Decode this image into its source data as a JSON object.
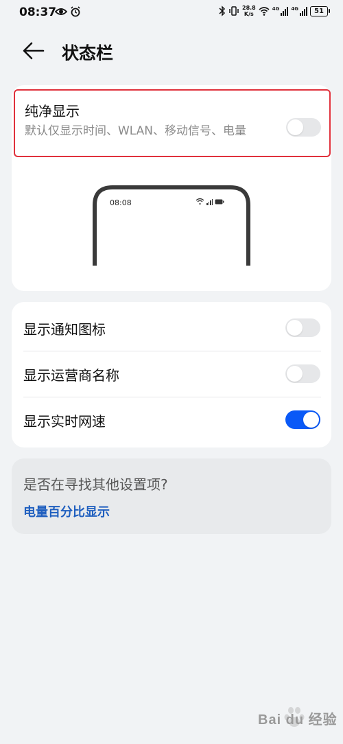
{
  "status_bar": {
    "time": "08:37",
    "net_speed_value": "28.8",
    "net_speed_unit": "K/s",
    "signal_1_label": "4G",
    "signal_2_label": "4G",
    "battery": "51",
    "icons": [
      "eye-icon",
      "alarm-icon",
      "bluetooth-icon",
      "vibrate-icon",
      "wifi-icon",
      "cell-signal-icon",
      "battery-icon"
    ]
  },
  "header": {
    "back_icon": "arrow-left-icon",
    "title": "状态栏"
  },
  "pure_display": {
    "title": "纯净显示",
    "description": "默认仅显示时间、WLAN、移动信号、电量",
    "enabled": false
  },
  "preview": {
    "time": "08:08"
  },
  "settings": [
    {
      "label": "显示通知图标",
      "enabled": false
    },
    {
      "label": "显示运营商名称",
      "enabled": false
    },
    {
      "label": "显示实时网速",
      "enabled": true
    }
  ],
  "suggestion": {
    "question": "是否在寻找其他设置项?",
    "link": "电量百分比显示"
  },
  "watermark": {
    "text": "Bai du 经验"
  },
  "colors": {
    "background": "#f1f3f5",
    "toggle_on": "#0a59f7",
    "toggle_off": "#e6e7e9",
    "highlight_border": "#e0313c",
    "link": "#1f5fbf"
  }
}
